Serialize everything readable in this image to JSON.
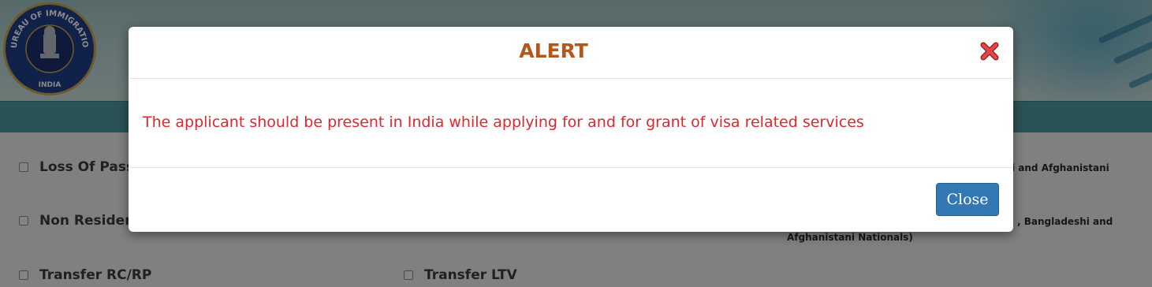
{
  "emblem": {
    "top_text": "BUREAU OF IMMIGRATION",
    "bottom_text": "INDIA"
  },
  "services": {
    "col1": [
      "Loss Of Pass",
      "Non Residen",
      "Transfer RC/RP"
    ],
    "col2": [
      "Transfer LTV"
    ],
    "col3": [
      "i and Afghanistani",
      ", Bangladeshi and",
      "Afghanistani Nationals)"
    ]
  },
  "modal": {
    "title": "ALERT",
    "message": "The applicant should be present in India while applying for and for grant of visa related services",
    "close_button": "Close",
    "close_icon": "close-icon"
  },
  "colors": {
    "title": "#b5561b",
    "message": "#e3262b",
    "button": "#3178b4",
    "navbar": "#4f9a9d"
  }
}
